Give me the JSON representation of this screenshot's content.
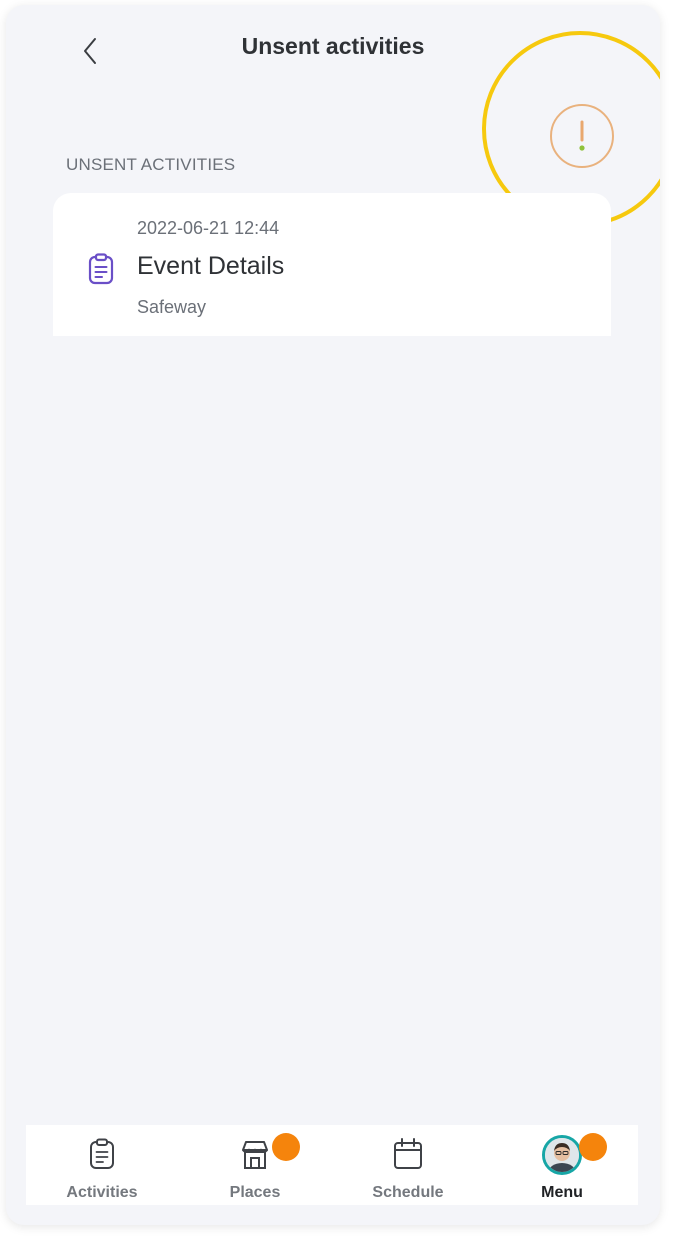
{
  "header": {
    "title": "Unsent activities"
  },
  "section": {
    "label": "UNSENT ACTIVITIES"
  },
  "activities": [
    {
      "datetime": "2022-06-21 12:44",
      "title": "Event Details",
      "place": "Safeway"
    }
  ],
  "bottom_nav": [
    {
      "label": "Activities",
      "icon": "clipboard-icon",
      "badge": false,
      "active": false
    },
    {
      "label": "Places",
      "icon": "store-icon",
      "badge": true,
      "active": false
    },
    {
      "label": "Schedule",
      "icon": "calendar-icon",
      "badge": false,
      "active": false
    },
    {
      "label": "Menu",
      "icon": "avatar",
      "badge": true,
      "active": true
    }
  ],
  "colors": {
    "highlight": "#f6c90e",
    "warning": "#e9b27e",
    "badge": "#f5840c",
    "accent": "#6a4fc7",
    "avatar_ring": "#17a6a6"
  }
}
